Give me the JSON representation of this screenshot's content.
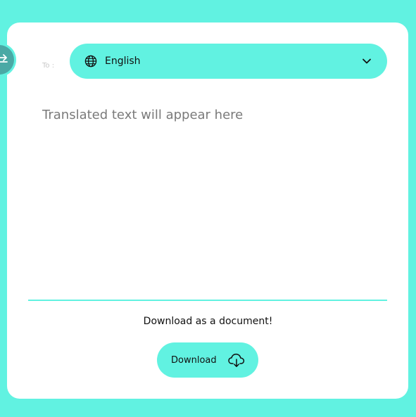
{
  "target": {
    "label": "To :",
    "language": "English"
  },
  "output": {
    "placeholder": "Translated text will appear here"
  },
  "download": {
    "caption": "Download as a document!",
    "button_label": "Download"
  },
  "icons": {
    "swap": "swap-arrows-icon",
    "language": "globe-icon",
    "dropdown": "chevron-down-icon",
    "download": "cloud-download-icon"
  },
  "colors": {
    "background": "#61f2e1",
    "card": "#ffffff",
    "swap_button": "#4aa9a5",
    "text": "#111111",
    "placeholder": "#7a7a7a"
  }
}
